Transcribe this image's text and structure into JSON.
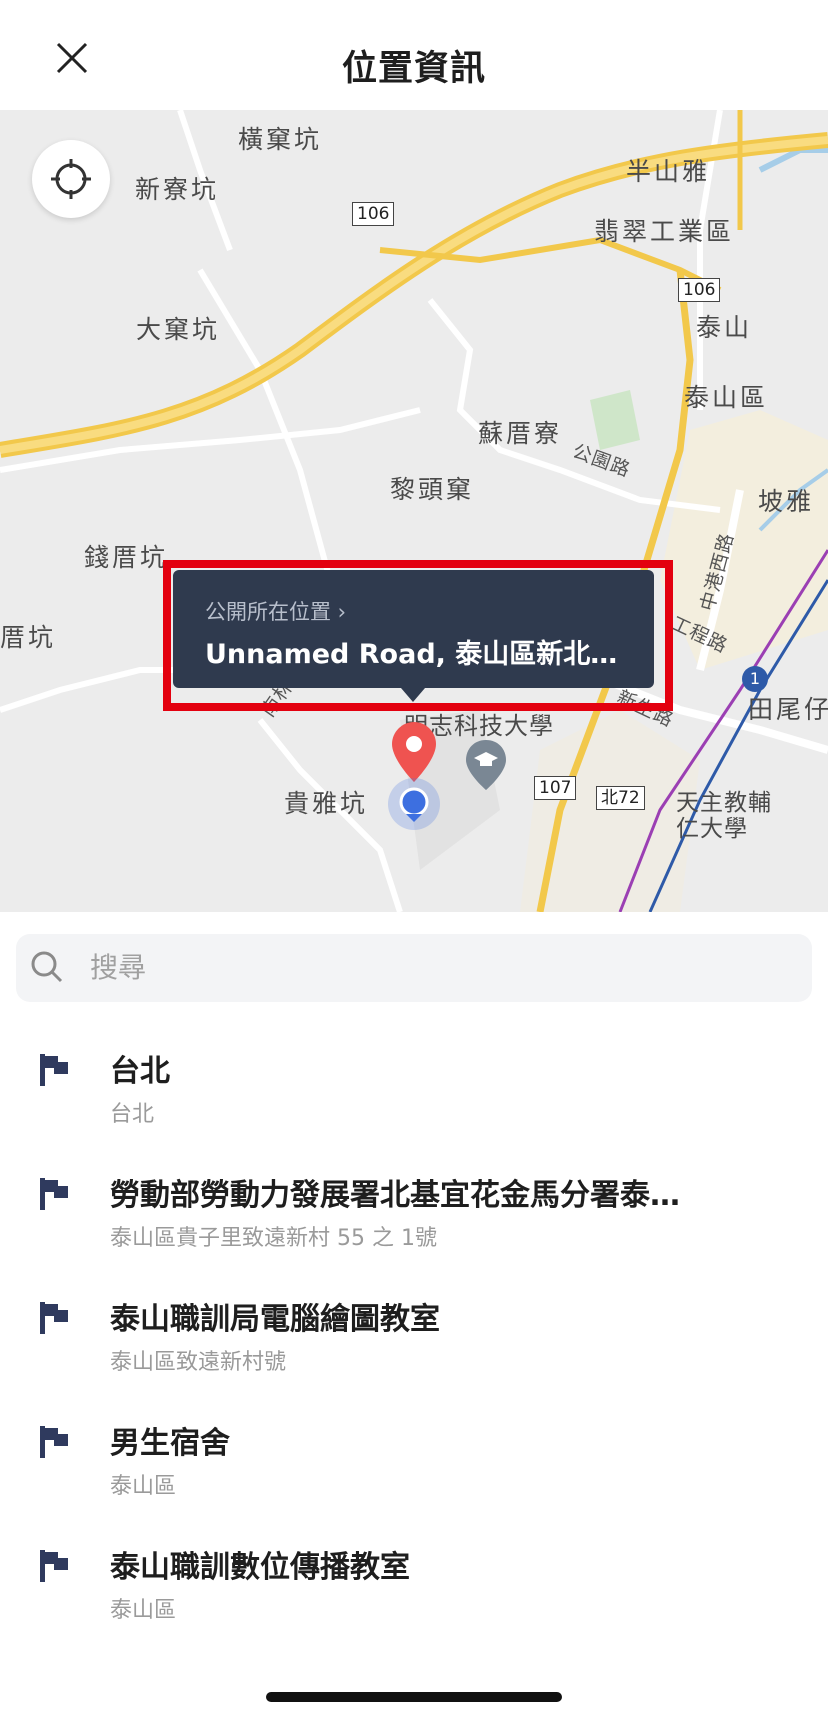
{
  "header": {
    "title": "位置資訊",
    "close_icon": "close-icon"
  },
  "map": {
    "labels": [
      "橫窠坑",
      "新寮坑",
      "大窠坑",
      "半山雅",
      "翡翠工業區",
      "泰山",
      "泰山區",
      "蘇厝寮",
      "黎頭窠",
      "錢厝坑",
      "厝坑",
      "坡雅",
      "明志科技大學",
      "貴雅坑",
      "天主教輔仁大學",
      "田尾仔"
    ],
    "road_labels": [
      "公園路",
      "南林路",
      "新生路",
      "中港西路",
      "工程路"
    ],
    "route_shields": [
      "106",
      "106",
      "107",
      "107",
      "北72",
      "1"
    ],
    "callout": {
      "label": "公開所在位置 ›",
      "address": "Unnamed Road, 泰山區新北…"
    },
    "colors": {
      "highway": "#f5c842",
      "callout": "#2f3a4e",
      "pin": "#ef5350",
      "highlight": "#e3000f"
    }
  },
  "search": {
    "placeholder": "搜尋"
  },
  "places": [
    {
      "name": "台北",
      "address": "台北"
    },
    {
      "name": "勞動部勞動力發展署北基宜花金馬分署泰…",
      "address": "泰山區貴子里致遠新村 55 之 1號"
    },
    {
      "name": "泰山職訓局電腦繪圖教室",
      "address": "泰山區致遠新村號"
    },
    {
      "name": "男生宿舍",
      "address": "泰山區"
    },
    {
      "name": "泰山職訓數位傳播教室",
      "address": "泰山區"
    }
  ]
}
